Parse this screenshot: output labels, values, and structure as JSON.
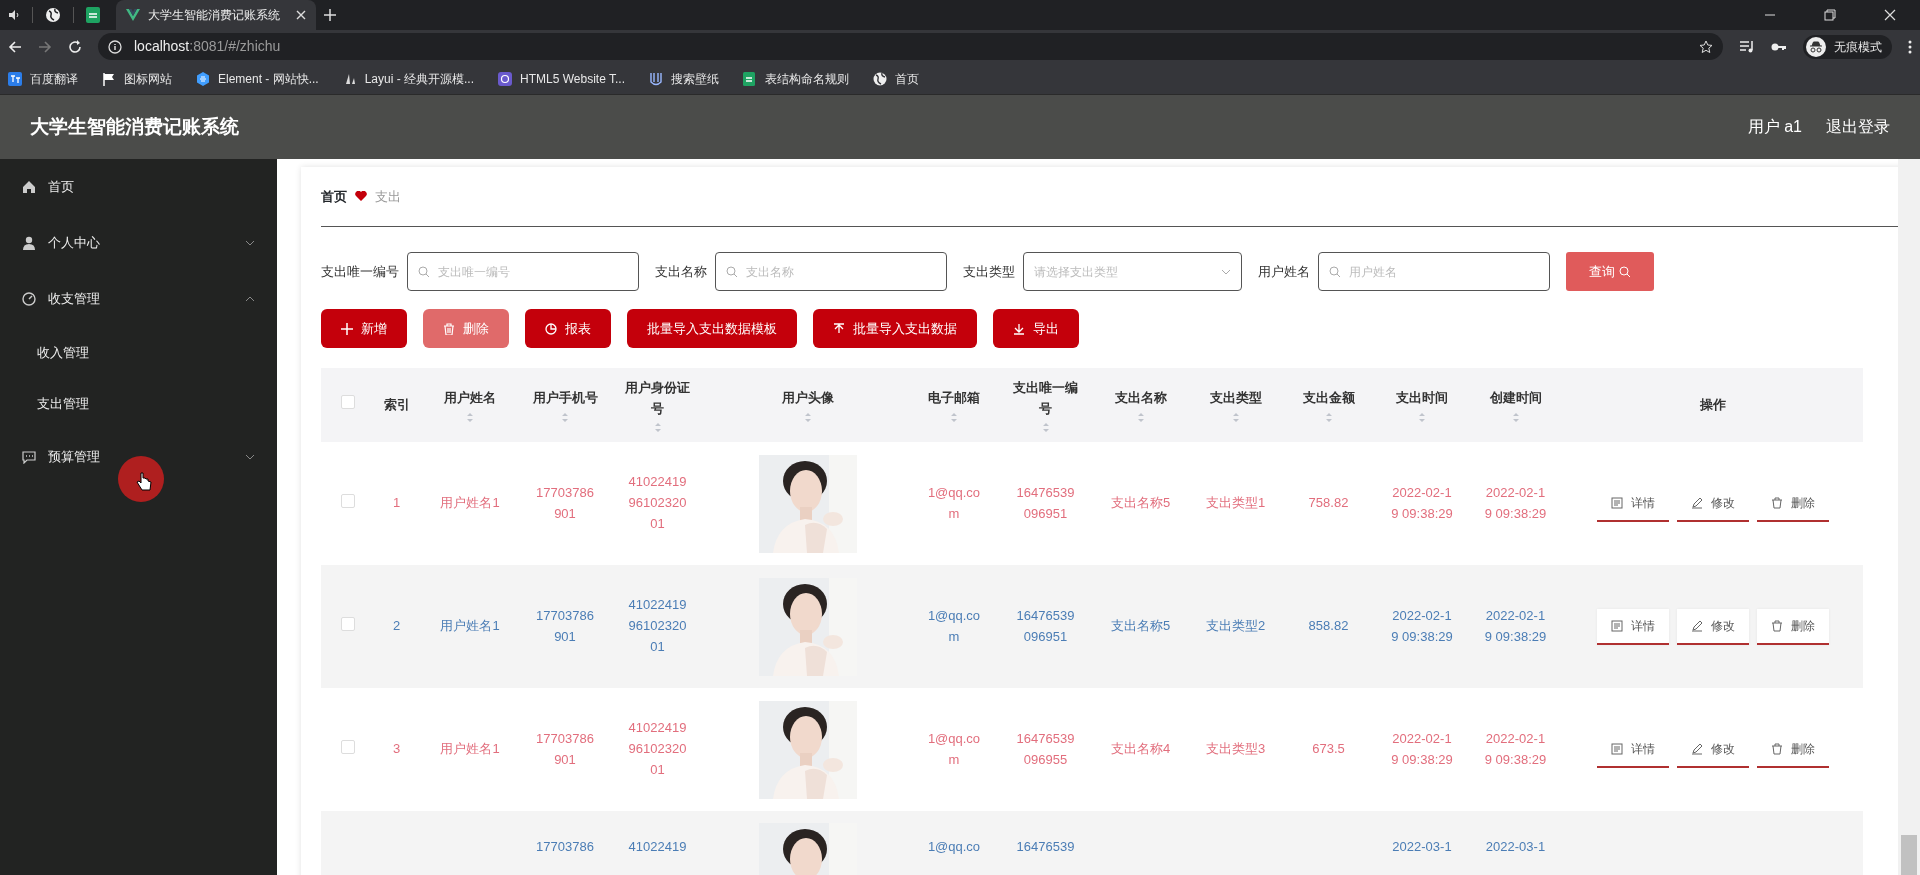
{
  "browser": {
    "active_tab": {
      "title": "大学生智能消费记账系统"
    },
    "address": {
      "host": "localhost",
      "path": ":8081/#/zhichu"
    },
    "profile": "无痕模式",
    "bookmarks": [
      {
        "label": "百度翻译",
        "kind": "translate"
      },
      {
        "label": "图标网站",
        "kind": "flag"
      },
      {
        "label": "Element - 网站快...",
        "kind": "element"
      },
      {
        "label": "Layui - 经典开源模...",
        "kind": "layui"
      },
      {
        "label": "HTML5 Website T...",
        "kind": "html5"
      },
      {
        "label": "搜索壁纸",
        "kind": "wallpaper"
      },
      {
        "label": "表结构命名规则",
        "kind": "sheet"
      },
      {
        "label": "首页",
        "kind": "globe"
      }
    ]
  },
  "app": {
    "title": "大学生智能消费记账系统",
    "user": "用户 a1",
    "logout": "退出登录"
  },
  "sidebar": {
    "items": [
      {
        "label": "首页",
        "kind": "home"
      },
      {
        "label": "个人中心",
        "kind": "user",
        "expanded": false
      },
      {
        "label": "收支管理",
        "kind": "gauge",
        "expanded": true,
        "children": [
          {
            "label": "收入管理"
          },
          {
            "label": "支出管理"
          }
        ]
      },
      {
        "label": "预算管理",
        "kind": "chat",
        "expanded": false
      }
    ]
  },
  "breadcrumb": [
    {
      "label": "首页",
      "current": false
    },
    {
      "label": "支出",
      "current": true
    }
  ],
  "filters": [
    {
      "label": "支出唯一编号",
      "placeholder": "支出唯一编号",
      "kind": "text"
    },
    {
      "label": "支出名称",
      "placeholder": "支出名称",
      "kind": "text"
    },
    {
      "label": "支出类型",
      "placeholder": "请选择支出类型",
      "kind": "select"
    },
    {
      "label": "用户姓名",
      "placeholder": "用户姓名",
      "kind": "text"
    }
  ],
  "search_button": "查询",
  "actions": [
    {
      "label": "新增",
      "kind": "add",
      "disabled": false
    },
    {
      "label": "删除",
      "kind": "delete",
      "disabled": true
    },
    {
      "label": "报表",
      "kind": "report",
      "disabled": false
    },
    {
      "label": "批量导入支出数据模板",
      "kind": "template",
      "disabled": false
    },
    {
      "label": "批量导入支出数据",
      "kind": "upload",
      "disabled": false
    },
    {
      "label": "导出",
      "kind": "export",
      "disabled": false
    }
  ],
  "table": {
    "header_checked": false,
    "columns": [
      {
        "label": "索引",
        "sortable": false
      },
      {
        "label": "用户姓名",
        "sortable": true
      },
      {
        "label": "用户手机号",
        "sortable": true
      },
      {
        "label": "用户身份证号",
        "sortable": true
      },
      {
        "label": "用户头像",
        "sortable": true
      },
      {
        "label": "电子邮箱",
        "sortable": true
      },
      {
        "label": "支出唯一编号",
        "sortable": true
      },
      {
        "label": "支出名称",
        "sortable": true
      },
      {
        "label": "支出类型",
        "sortable": true
      },
      {
        "label": "支出金额",
        "sortable": true
      },
      {
        "label": "支出时间",
        "sortable": true
      },
      {
        "label": "创建时间",
        "sortable": true
      },
      {
        "label": "操作",
        "sortable": false
      }
    ],
    "rows": [
      {
        "checked": false,
        "index": "1",
        "name": "用户姓名1",
        "phone": "17703786901",
        "id_card": "410224199610232001",
        "email": "1@qq.com",
        "uid": "16476539096951",
        "expense_name": "支出名称5",
        "expense_type": "支出类型1",
        "amount": "758.82",
        "spend_time": "2022-02-19 09:38:29",
        "create_time": "2022-02-19 09:38:29",
        "ops": [
          "详情",
          "修改",
          "删除"
        ]
      },
      {
        "checked": false,
        "index": "2",
        "name": "用户姓名1",
        "phone": "17703786901",
        "id_card": "410224199610232001",
        "email": "1@qq.com",
        "uid": "16476539096951",
        "expense_name": "支出名称5",
        "expense_type": "支出类型2",
        "amount": "858.82",
        "spend_time": "2022-02-19 09:38:29",
        "create_time": "2022-02-19 09:38:29",
        "ops": [
          "详情",
          "修改",
          "删除"
        ]
      },
      {
        "checked": false,
        "index": "3",
        "name": "用户姓名1",
        "phone": "17703786901",
        "id_card": "410224199610232001",
        "email": "1@qq.com",
        "uid": "16476539096955",
        "expense_name": "支出名称4",
        "expense_type": "支出类型3",
        "amount": "673.5",
        "spend_time": "2022-02-19 09:38:29",
        "create_time": "2022-02-19 09:38:29",
        "ops": [
          "详情",
          "修改",
          "删除"
        ]
      },
      {
        "phone": "17703786",
        "id_card": "41022419",
        "email": "1@qq.co",
        "uid": "16476539",
        "spend_time": "2022-03-1",
        "create_time": "2022-03-1"
      }
    ]
  }
}
